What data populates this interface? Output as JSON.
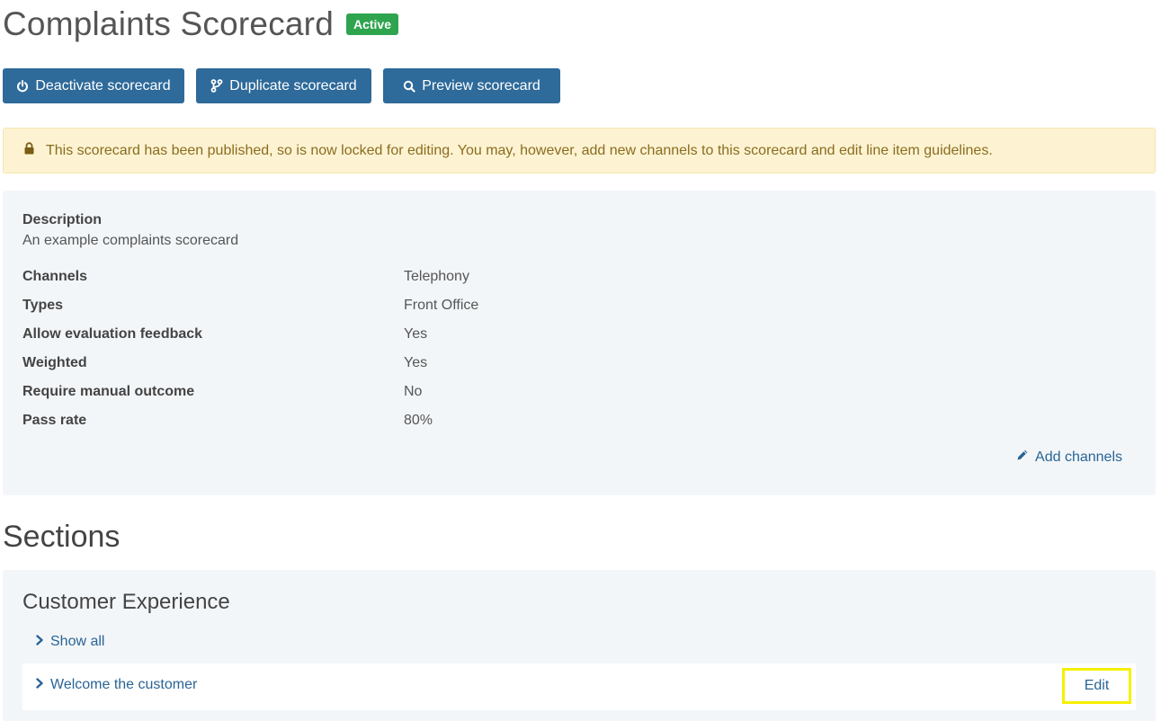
{
  "header": {
    "title": "Complaints Scorecard",
    "status_badge": "Active"
  },
  "toolbar": {
    "deactivate_label": "Deactivate scorecard",
    "duplicate_label": "Duplicate scorecard",
    "preview_label": "Preview scorecard"
  },
  "alert": {
    "icon": "lock-icon",
    "text": "This scorecard has been published, so is now locked for editing. You may, however, add new channels to this scorecard and edit line item guidelines."
  },
  "details": {
    "description_label": "Description",
    "description_value": "An example complaints scorecard",
    "rows": [
      {
        "label": "Channels",
        "value": "Telephony"
      },
      {
        "label": "Types",
        "value": "Front Office"
      },
      {
        "label": "Allow evaluation feedback",
        "value": "Yes"
      },
      {
        "label": "Weighted",
        "value": "Yes"
      },
      {
        "label": "Require manual outcome",
        "value": "No"
      },
      {
        "label": "Pass rate",
        "value": "80%"
      }
    ],
    "add_channels_label": "Add channels"
  },
  "sections": {
    "heading": "Sections",
    "items": [
      {
        "name": "Customer Experience",
        "show_all_label": "Show all",
        "line_items": [
          {
            "label": "Welcome the customer",
            "edit_label": "Edit"
          }
        ]
      }
    ]
  },
  "colors": {
    "primary_button": "#2e6a9a",
    "badge_green": "#2ea44f",
    "alert_bg": "#fdf3d3",
    "alert_text": "#8a6d1e",
    "link": "#2a6496",
    "panel_bg": "#f3f6f9",
    "highlight": "#f6f000"
  }
}
